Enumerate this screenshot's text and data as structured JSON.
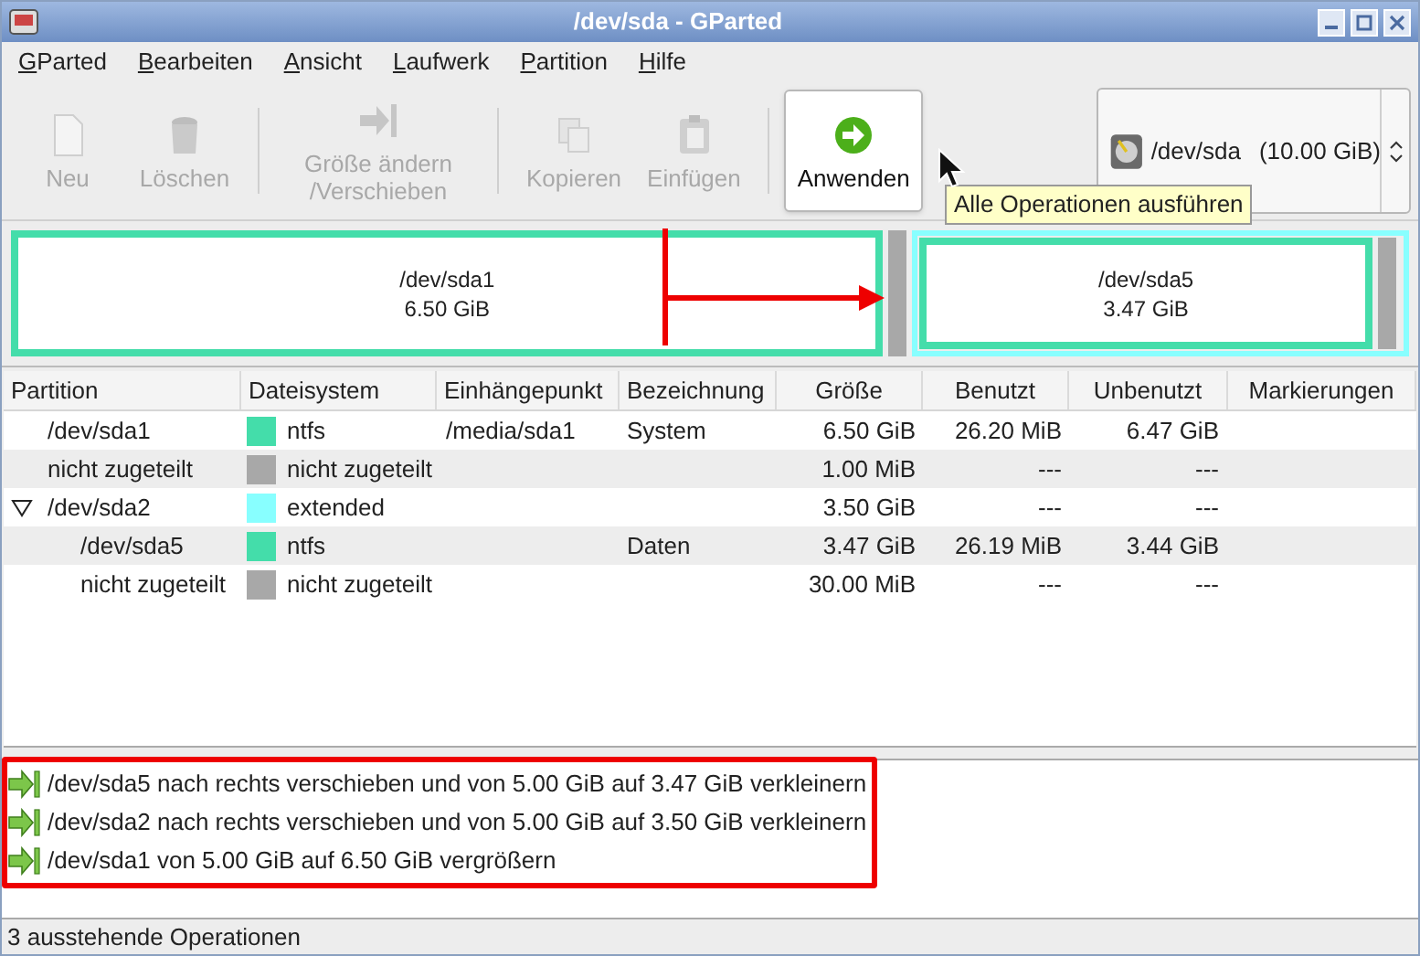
{
  "window": {
    "title": "/dev/sda - GParted"
  },
  "menu": [
    "GParted",
    "Bearbeiten",
    "Ansicht",
    "Laufwerk",
    "Partition",
    "Hilfe"
  ],
  "toolbar": [
    {
      "kind": "button",
      "label": "Neu",
      "disabled": true
    },
    {
      "kind": "button",
      "label": "Löschen",
      "disabled": true
    },
    {
      "kind": "separator"
    },
    {
      "kind": "button",
      "label": "Größe ändern /Verschieben",
      "disabled": true
    },
    {
      "kind": "separator"
    },
    {
      "kind": "button",
      "label": "Kopieren",
      "disabled": true
    },
    {
      "kind": "button",
      "label": "Einfügen",
      "disabled": true
    },
    {
      "kind": "separator"
    },
    {
      "kind": "button",
      "label": "Anwenden",
      "disabled": false,
      "hovered": true
    }
  ],
  "tooltip": "Alle Operationen ausführen",
  "device_selector": {
    "device": "/dev/sda",
    "size": "(10.00 GiB)"
  },
  "disk_map": [
    {
      "kind": "partition",
      "name": "/dev/sda1",
      "size": "6.50 GiB",
      "color": "#44ddaa"
    },
    {
      "kind": "unallocated"
    },
    {
      "kind": "extended",
      "color": "#88ffff",
      "children": [
        {
          "kind": "partition",
          "name": "/dev/sda5",
          "size": "3.47 GiB",
          "color": "#44ddaa"
        },
        {
          "kind": "unallocated"
        }
      ]
    }
  ],
  "table": {
    "columns": [
      "Partition",
      "Dateisystem",
      "Einhängepunkt",
      "Bezeichnung",
      "Größe",
      "Benutzt",
      "Unbenutzt",
      "Markierungen"
    ],
    "rows": [
      {
        "partition": "/dev/sda1",
        "filesystem": "ntfs",
        "color": "#44ddaa",
        "mountpoint": "/media/sda1",
        "label": "System",
        "size": "6.50 GiB",
        "used": "26.20 MiB",
        "unused": "6.47 GiB"
      },
      {
        "partition": "nicht zugeteilt",
        "filesystem": "nicht zugeteilt",
        "color": "#a8a8a8",
        "size": "1.00 MiB",
        "used": "---",
        "unused": "---"
      },
      {
        "partition": "/dev/sda2",
        "filesystem": "extended",
        "color": "#88ffff",
        "size": "3.50 GiB",
        "used": "---",
        "unused": "---",
        "expanded": true,
        "children": [
          {
            "partition": "/dev/sda5",
            "filesystem": "ntfs",
            "color": "#44ddaa",
            "label": "Daten",
            "size": "3.47 GiB",
            "used": "26.19 MiB",
            "unused": "3.44 GiB"
          },
          {
            "partition": "nicht zugeteilt",
            "filesystem": "nicht zugeteilt",
            "color": "#a8a8a8",
            "size": "30.00 MiB",
            "used": "---",
            "unused": "---"
          }
        ]
      }
    ]
  },
  "operations": [
    "/dev/sda5 nach rechts verschieben und von 5.00 GiB auf 3.47 GiB verkleinern",
    "/dev/sda2 nach rechts verschieben und von 5.00 GiB auf 3.50 GiB verkleinern",
    "/dev/sda1 von 5.00 GiB auf 6.50 GiB vergrößern"
  ],
  "status_bar": "3 ausstehende Operationen"
}
